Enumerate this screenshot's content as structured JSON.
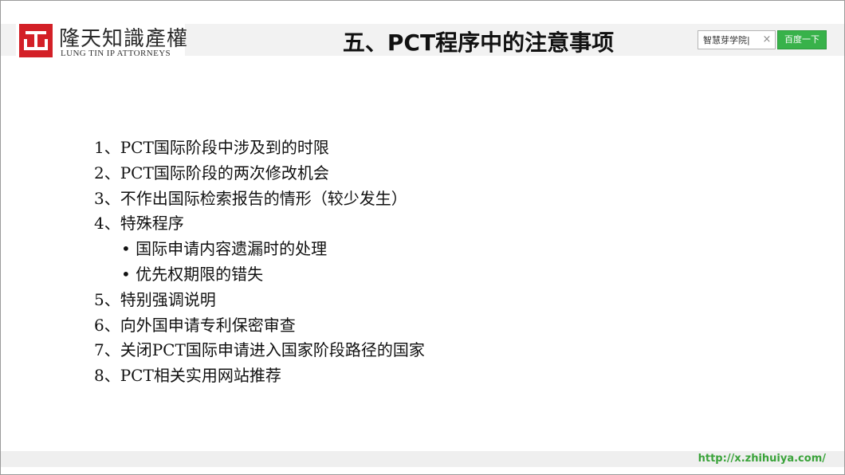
{
  "logo": {
    "name_cn": "隆天知識產權",
    "name_en": "LUNG TIN IP ATTORNEYS",
    "mark_color": "#d32027"
  },
  "title": "五、PCT程序中的注意事项",
  "search": {
    "value": "智慧芽学院|",
    "clear_icon": "×",
    "button_label": "百度一下",
    "button_color": "#38b24a"
  },
  "agenda": {
    "items": [
      "1、PCT国际阶段中涉及到的时限",
      "2、PCT国际阶段的两次修改机会",
      "3、不作出国际检索报告的情形（较少发生）",
      "4、特殊程序",
      "• 国际申请内容遗漏时的处理",
      "• 优先权期限的错失",
      "5、特别强调说明",
      "6、向外国申请专利保密审查",
      "7、关闭PCT国际申请进入国家阶段路径的国家",
      "8、PCT相关实用网站推荐"
    ]
  },
  "footer": {
    "url": "http://x.zhihuiya.com/",
    "url_color": "#3aa33a"
  }
}
